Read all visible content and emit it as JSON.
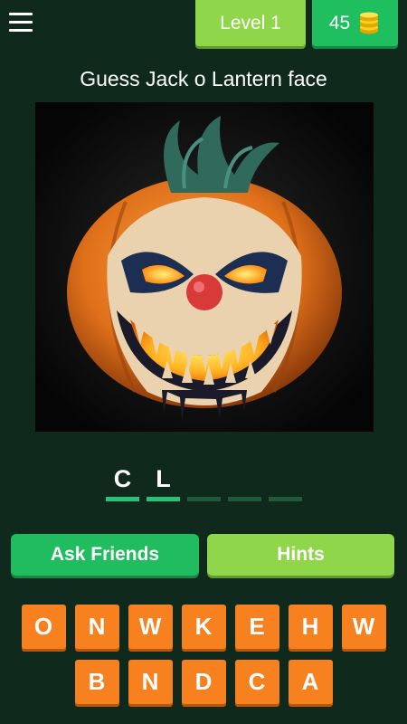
{
  "header": {
    "level_label": "Level 1",
    "coins": "45"
  },
  "question": "Guess Jack o Lantern face",
  "answer": {
    "slots": [
      "C",
      "L",
      "",
      "",
      ""
    ]
  },
  "buttons": {
    "ask_friends": "Ask Friends",
    "hints": "Hints"
  },
  "letters": {
    "row1": [
      "O",
      "N",
      "W",
      "K",
      "E",
      "H",
      "W"
    ],
    "row2": [
      "B",
      "N",
      "D",
      "C",
      "A"
    ]
  },
  "colors": {
    "background": "#0f2a1d",
    "level_badge": "#8fd64a",
    "coins_badge": "#1fbe5e",
    "letter_key": "#f7801f",
    "slot_filled": "#27c27a",
    "slot_empty": "#1f5a3a"
  },
  "icons": {
    "menu": "hamburger-icon",
    "coins": "coin-stack-icon"
  }
}
